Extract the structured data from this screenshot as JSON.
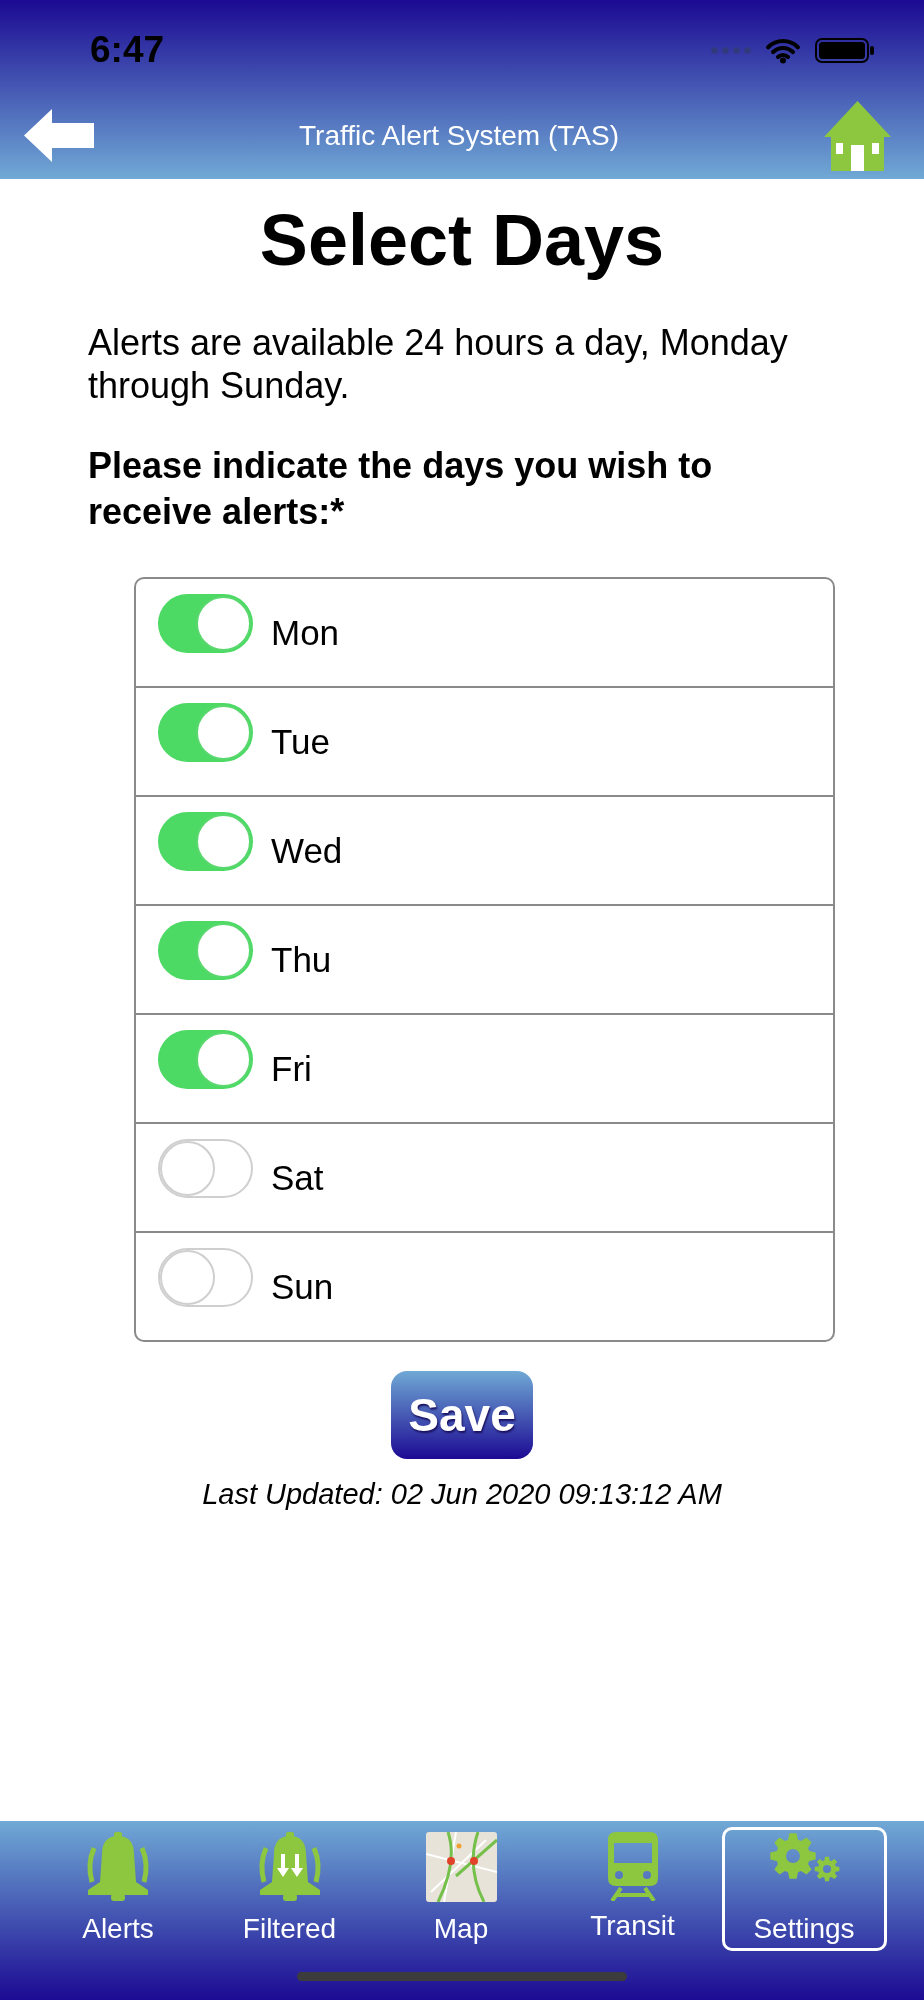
{
  "status_bar": {
    "time": "6:47"
  },
  "nav_bar": {
    "title": "Traffic Alert System (TAS)"
  },
  "page": {
    "title": "Select Days",
    "intro": "Alerts are available 24 hours a day, Monday through Sunday.",
    "prompt": "Please indicate the days you wish to receive alerts:*"
  },
  "days": [
    {
      "label": "Mon",
      "on": true
    },
    {
      "label": "Tue",
      "on": true
    },
    {
      "label": "Wed",
      "on": true
    },
    {
      "label": "Thu",
      "on": true
    },
    {
      "label": "Fri",
      "on": true
    },
    {
      "label": "Sat",
      "on": false
    },
    {
      "label": "Sun",
      "on": false
    }
  ],
  "save_button": {
    "label": "Save"
  },
  "last_updated": "Last Updated: 02 Jun 2020 09:13:12 AM",
  "tab_bar": [
    {
      "kind": "bell",
      "label": "Alerts",
      "selected": false
    },
    {
      "kind": "filtered",
      "label": "Filtered",
      "selected": false
    },
    {
      "kind": "map",
      "label": "Map",
      "selected": false
    },
    {
      "kind": "transit",
      "label": "Transit",
      "selected": false
    },
    {
      "kind": "settings",
      "label": "Settings",
      "selected": true
    }
  ]
}
